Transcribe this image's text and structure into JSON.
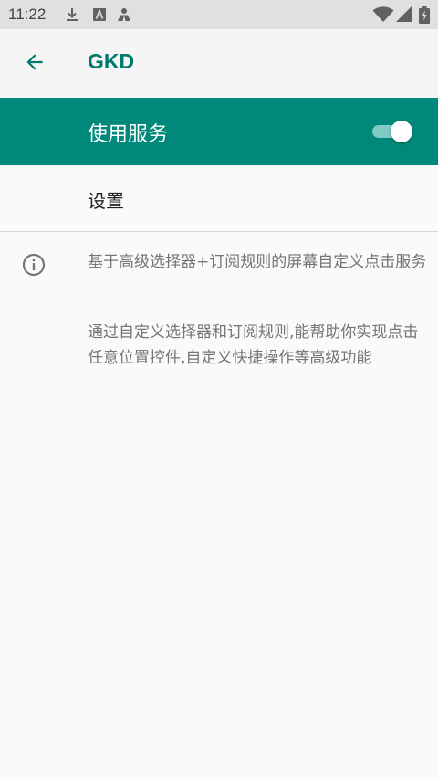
{
  "status_bar": {
    "time": "11:22",
    "notification_icons": [
      "download-icon",
      "text-a-icon",
      "person-icon"
    ],
    "system_icons": [
      "wifi-icon",
      "cell-signal-icon",
      "battery-charging-icon"
    ]
  },
  "app_bar": {
    "back_icon": "arrow-back-icon",
    "title": "GKD",
    "title_color": "#00796b"
  },
  "service": {
    "label": "使用服务",
    "enabled": true,
    "background_color": "#00897b"
  },
  "settings": {
    "label": "设置"
  },
  "info": {
    "icon": "info-icon",
    "paragraph_1": "基于高级选择器+订阅规则的屏幕自定义点击服务",
    "paragraph_2": "通过自定义选择器和订阅规则,能帮助你实现点击任意位置控件,自定义快捷操作等高级功能"
  }
}
